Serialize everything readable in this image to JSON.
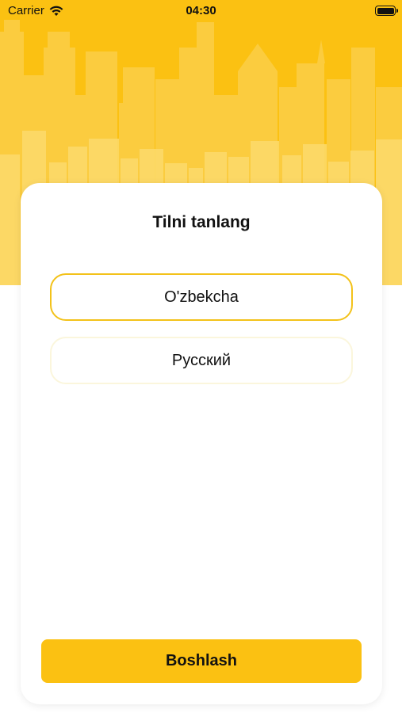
{
  "status_bar": {
    "carrier": "Carrier",
    "time": "04:30"
  },
  "card": {
    "title": "Tilni tanlang",
    "languages": [
      {
        "label": "O'zbekcha",
        "selected": true
      },
      {
        "label": "Русский",
        "selected": false
      }
    ],
    "start_button": "Boshlash"
  },
  "colors": {
    "accent": "#FBC112",
    "selected_border": "#F3C21A",
    "unselected_border": "#FBF6DC"
  }
}
